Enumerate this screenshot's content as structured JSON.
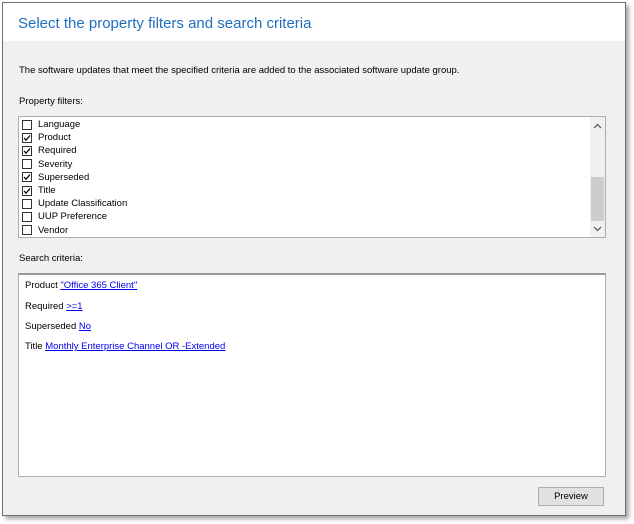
{
  "header": {
    "title": "Select the property filters and search criteria"
  },
  "description": "The software updates that meet the specified criteria are added to the associated software update group.",
  "property_filters": {
    "label": "Property filters:",
    "items": [
      {
        "label": "Language",
        "checked": false
      },
      {
        "label": "Product",
        "checked": true
      },
      {
        "label": "Required",
        "checked": true
      },
      {
        "label": "Severity",
        "checked": false
      },
      {
        "label": "Superseded",
        "checked": true
      },
      {
        "label": "Title",
        "checked": true
      },
      {
        "label": "Update Classification",
        "checked": false
      },
      {
        "label": "UUP Preference",
        "checked": false
      },
      {
        "label": "Vendor",
        "checked": false
      }
    ]
  },
  "search_criteria": {
    "label": "Search criteria:",
    "rows": [
      {
        "field": "Product",
        "value": "\"Office 365 Client\""
      },
      {
        "field": "Required",
        "value": ">=1"
      },
      {
        "field": "Superseded",
        "value": "No"
      },
      {
        "field": "Title",
        "value": "Monthly Enterprise Channel OR -Extended"
      }
    ]
  },
  "buttons": {
    "preview": "Preview"
  }
}
